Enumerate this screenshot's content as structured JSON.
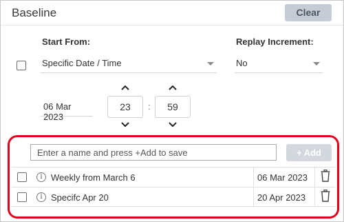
{
  "header": {
    "title": "Baseline",
    "clear_label": "Clear"
  },
  "form": {
    "start_from_label": "Start From:",
    "replay_increment_label": "Replay Increment:",
    "start_from_value": "Specific Date / Time",
    "replay_increment_value": "No",
    "date_value": "06 Mar 2023",
    "hour_value": "23",
    "minute_value": "59",
    "colon": ":"
  },
  "saved": {
    "input_placeholder": "Enter a name and press +Add to save",
    "add_label": "+ Add",
    "rows": [
      {
        "name": "Weekly from March 6",
        "date": "06 Mar 2023"
      },
      {
        "name": "Specifc Apr 20",
        "date": "20 Apr 2023"
      }
    ]
  },
  "icons": {
    "up": "chevron-up-icon",
    "down": "chevron-down-icon",
    "info": "info-icon",
    "trash": "trash-icon"
  },
  "colors": {
    "highlight": "#e3001b",
    "button_disabled": "#d3d8de",
    "clear_button": "#c5ccd5"
  }
}
